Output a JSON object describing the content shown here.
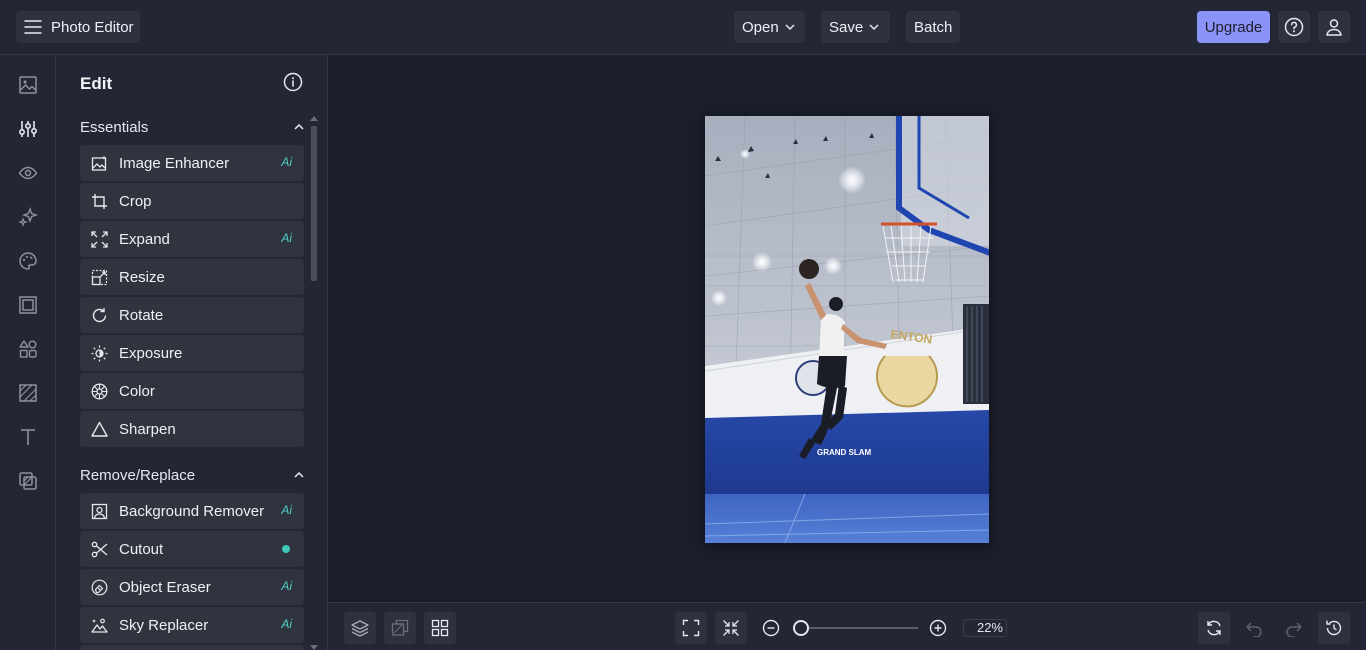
{
  "header": {
    "app_title": "Photo Editor",
    "menu_icon": "hamburger-menu-icon",
    "open_label": "Open",
    "save_label": "Save",
    "batch_label": "Batch",
    "upgrade_label": "Upgrade",
    "accent_color": "#8b93f8"
  },
  "rail": {
    "items": [
      "image-icon",
      "sliders-icon",
      "eye-icon",
      "sparkles-icon",
      "palette-icon",
      "frame-icon",
      "elements-icon",
      "texture-icon",
      "text-icon",
      "overlay-icon"
    ],
    "active": "sliders-icon"
  },
  "panel": {
    "title": "Edit",
    "sections": [
      {
        "title": "Essentials",
        "tools": [
          {
            "label": "Image Enhancer",
            "badge": "Ai"
          },
          {
            "label": "Crop",
            "badge": ""
          },
          {
            "label": "Expand",
            "badge": "Ai"
          },
          {
            "label": "Resize",
            "badge": ""
          },
          {
            "label": "Rotate",
            "badge": ""
          },
          {
            "label": "Exposure",
            "badge": ""
          },
          {
            "label": "Color",
            "badge": ""
          },
          {
            "label": "Sharpen",
            "badge": ""
          }
        ]
      },
      {
        "title": "Remove/Replace",
        "tools": [
          {
            "label": "Background Remover",
            "badge": "Ai"
          },
          {
            "label": "Cutout",
            "badge": "dot"
          },
          {
            "label": "Object Eraser",
            "badge": "Ai"
          },
          {
            "label": "Sky Replacer",
            "badge": "Ai"
          }
        ]
      }
    ]
  },
  "canvas": {
    "photo_banner_text": "GRAND SLAM"
  },
  "footer": {
    "zoom_value": "22%",
    "zoom_fraction": 0.0
  }
}
